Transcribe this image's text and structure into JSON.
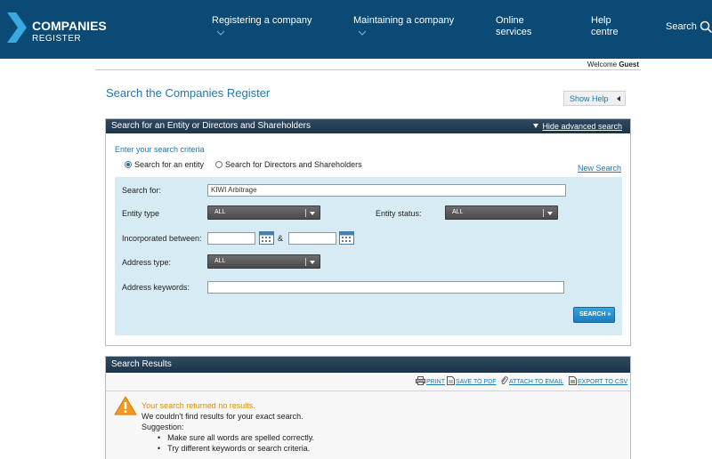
{
  "header": {
    "logo_line1": "COMPANIES",
    "logo_line2": "REGISTER",
    "nav": [
      {
        "label": "Registering a company",
        "has_chevron": true
      },
      {
        "label": "Maintaining a company",
        "has_chevron": true
      },
      {
        "label": "Online services"
      },
      {
        "label": "Help centre"
      }
    ],
    "search_label": "Search",
    "search_icon": "search-icon",
    "background": "#0a4a74"
  },
  "welcome": {
    "prefix": "Welcome",
    "user": "Guest"
  },
  "page": {
    "title": "Search the Companies Register",
    "show_help": "Show Help"
  },
  "search_panel": {
    "title": "Search for an Entity or Directors and Shareholders",
    "advanced_link": "Hide advanced search",
    "criteria_label": "Enter your search criteria",
    "radio_entity": "Search for an entity",
    "radio_directors": "Search for Directors and Shareholders",
    "selected_radio": "entity",
    "new_search": "New Search",
    "fields": {
      "search_for_label": "Search for:",
      "search_for_value": "KIWI Arbitrage",
      "entity_type_label": "Entity type",
      "entity_type_value": "ALL",
      "entity_status_label": "Entity status:",
      "entity_status_value": "ALL",
      "incorporated_label": "Incorporated between:",
      "incorporated_from": "",
      "incorporated_to": "",
      "ampersand": "&",
      "address_type_label": "Address type:",
      "address_type_value": "ALL",
      "address_keywords_label": "Address keywords:",
      "address_keywords_value": ""
    },
    "search_button": "SEARCH »",
    "form_bg": "#d6ebf3"
  },
  "results_panel": {
    "title": "Search Results",
    "toolbar": {
      "print": "PRINT",
      "save_pdf": "SAVE TO PDF",
      "attach_email": "ATTACH TO EMAIL",
      "export_csv": "EXPORT TO CSV"
    },
    "warning_title": "Your search returned no results.",
    "warning_text": "We couldn't find results for your exact search.",
    "suggestion_label": "Suggestion:",
    "suggestions": [
      "Make sure all words are spelled correctly.",
      "Try different keywords or search criteria."
    ],
    "warning_color": "#e08a14"
  }
}
